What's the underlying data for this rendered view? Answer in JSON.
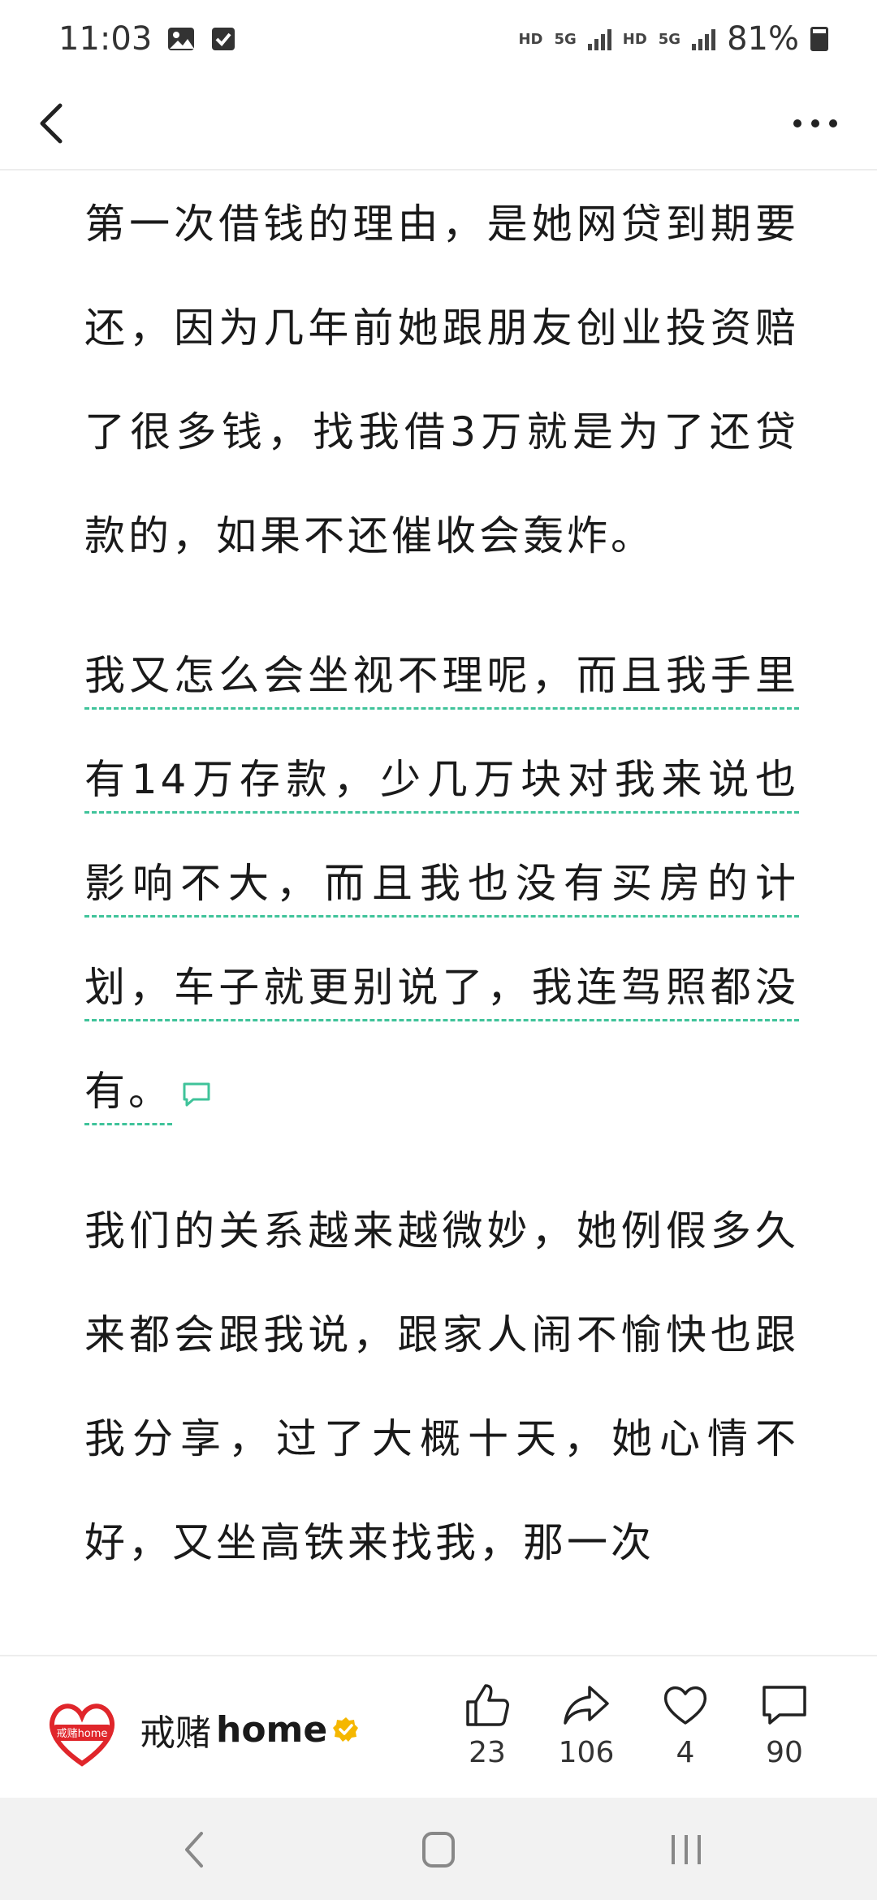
{
  "status_bar": {
    "time": "11:03",
    "left_icons": [
      "image-icon",
      "checkbox-icon"
    ],
    "hd1": "HD",
    "net1": "5G",
    "hd2": "HD",
    "net2": "5G",
    "battery_text": "81%",
    "battery_level": 0.81
  },
  "nav": {
    "back_icon": "chevron-left-icon",
    "more_icon": "more-horizontal-icon"
  },
  "article": {
    "paragraph1": "第一次借钱的理由，是她网贷到期要还，因为几年前她跟朋友创业投资赔了很多钱，找我借3万就是为了还贷款的，如果不还催收会轰炸。",
    "paragraph2": "我又怎么会坐视不理呢，而且我手里有14万存款，少几万块对我来说也影响不大，而且我也没有买房的计划，车子就更别说了，我连驾照都没有。",
    "paragraph3": "我们的关系越来越微妙，她例假多久来都会跟我说，跟家人闹不愉快也跟我分享，过了大概十天，她心情不好，又坐高铁来找我，那一次"
  },
  "author": {
    "logo_icon": "heart-logo-icon",
    "logo_text": "戒赌home",
    "name_cn": "戒赌",
    "name_latin": "home",
    "verified_icon": "verified-badge-icon"
  },
  "actions": {
    "like": {
      "icon": "thumbs-up-icon",
      "count": "23"
    },
    "share": {
      "icon": "share-arrow-icon",
      "count": "106"
    },
    "favorite": {
      "icon": "heart-icon",
      "count": "4"
    },
    "comment": {
      "icon": "comment-icon",
      "count": "90"
    }
  },
  "colors": {
    "accent": "#3fc39a",
    "verified": "#f5b700",
    "logo_red": "#e0262b"
  }
}
